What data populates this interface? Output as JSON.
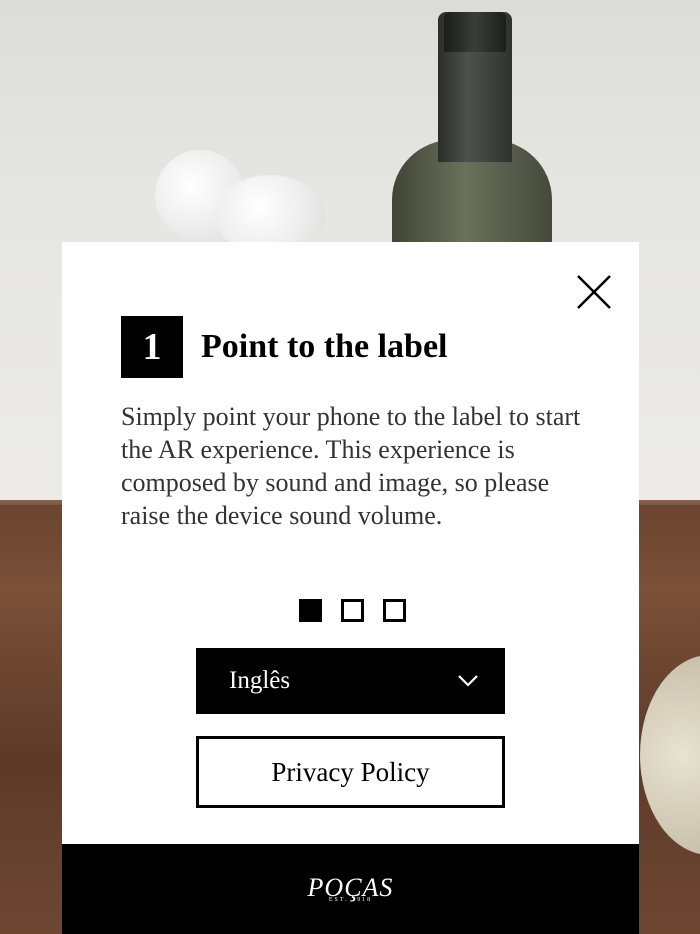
{
  "step": {
    "number": "1",
    "title": "Point to the label"
  },
  "description": "Simply point your phone to the label to start the AR experience. This experience is composed by sound and image, so please raise the device sound volume.",
  "pagination": {
    "total": 3,
    "current": 1
  },
  "language_select": {
    "selected": "Inglês",
    "icon": "chevron-down-icon"
  },
  "privacy_button": {
    "label": "Privacy Policy"
  },
  "close_button": {
    "icon": "close-icon"
  },
  "brand": {
    "name": "POÇAS",
    "tagline": "EST. 1918"
  },
  "colors": {
    "modal_bg": "#ffffff",
    "accent": "#000000",
    "text": "#333333"
  }
}
